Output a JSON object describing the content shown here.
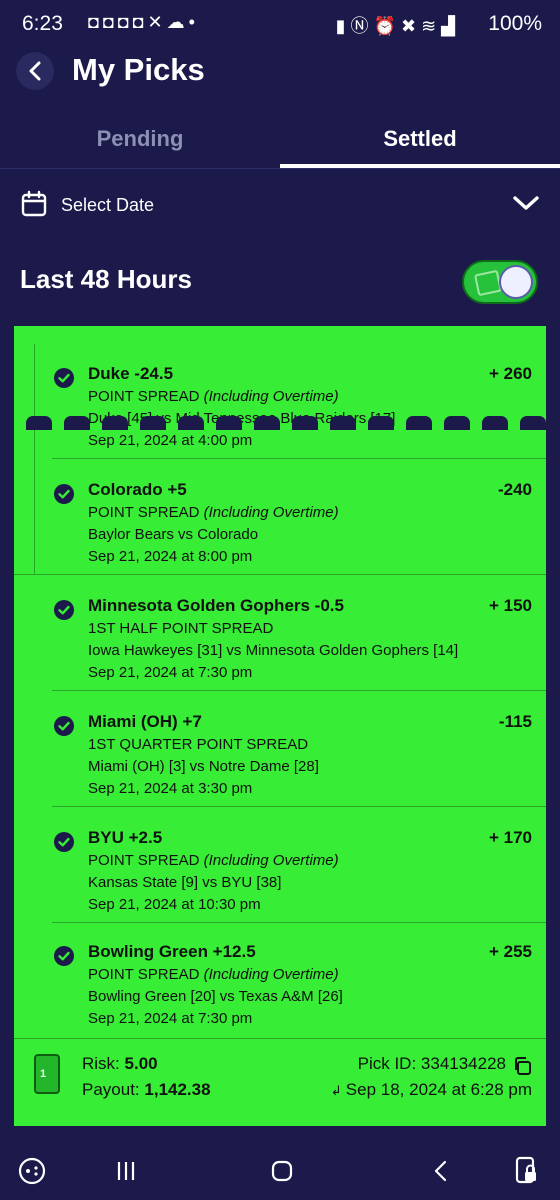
{
  "status_bar": {
    "time": "6:23",
    "notification_icons": [
      "discord-icon",
      "discord-icon",
      "discord-icon",
      "discord-icon",
      "x-icon",
      "weather-icon"
    ],
    "battery": "100%"
  },
  "header": {
    "title": "My Picks"
  },
  "tabs": [
    {
      "label": "Pending",
      "active": false
    },
    {
      "label": "Settled",
      "active": true
    }
  ],
  "date_filter": {
    "label": "Select Date"
  },
  "range": {
    "label": "Last 48 Hours",
    "toggle_on": true
  },
  "legs": [
    {
      "selection": "Duke -24.5",
      "odds": "+ 260",
      "market": "POINT SPREAD",
      "market_note": "(Including Overtime)",
      "matchup": "Duke [45] vs Mid Tennessee Blue Raiders [17]",
      "datetime": "Sep 21, 2024 at 4:00 pm"
    },
    {
      "selection": "Colorado +5",
      "odds": "-240",
      "market": "POINT SPREAD",
      "market_note": "(Including Overtime)",
      "matchup": "Baylor Bears vs Colorado",
      "datetime": "Sep 21, 2024 at 8:00 pm"
    },
    {
      "selection": "Minnesota Golden Gophers -0.5",
      "odds": "+ 150",
      "market": "1ST HALF POINT SPREAD",
      "market_note": "",
      "matchup": "Iowa Hawkeyes [31] vs Minnesota Golden Gophers [14]",
      "datetime": "Sep 21, 2024 at 7:30 pm"
    },
    {
      "selection": "Miami (OH) +7",
      "odds": "-115",
      "market": "1ST QUARTER POINT SPREAD",
      "market_note": "",
      "matchup": "Miami (OH) [3] vs Notre Dame [28]",
      "datetime": "Sep 21, 2024 at 3:30 pm"
    },
    {
      "selection": "BYU +2.5",
      "odds": "+ 170",
      "market": "POINT SPREAD",
      "market_note": "(Including Overtime)",
      "matchup": "Kansas State [9] vs BYU [38]",
      "datetime": "Sep 21, 2024 at 10:30 pm"
    },
    {
      "selection": "Bowling Green +12.5",
      "odds": "+ 255",
      "market": "POINT SPREAD",
      "market_note": "(Including Overtime)",
      "matchup": "Bowling Green [20] vs Texas A&M [26]",
      "datetime": "Sep 21, 2024 at 7:30 pm"
    }
  ],
  "footer": {
    "risk_label": "Risk:",
    "risk_value": "5.00",
    "payout_label": "Payout:",
    "payout_value": "1,142.38",
    "pick_id_label": "Pick ID:",
    "pick_id_value": "334134228",
    "placed": "Sep 18, 2024 at 6:28 pm"
  },
  "colors": {
    "background": "#1b1a4a",
    "card": "#37ed35",
    "check": "#1b1a4a"
  }
}
